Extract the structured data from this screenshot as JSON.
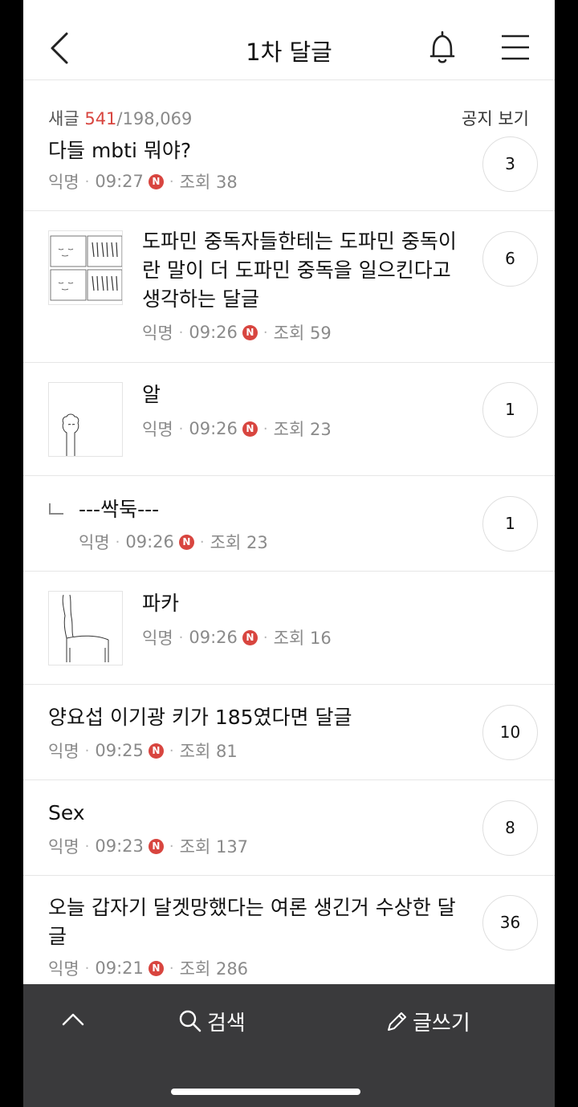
{
  "header": {
    "title": "1차 달글",
    "back_icon": "chevron-left-icon",
    "bell_icon": "bell-icon",
    "menu_icon": "hamburger-menu-icon"
  },
  "summary": {
    "new_label": "새글",
    "new_count": "541",
    "total": "/198,069",
    "notice_label": "공지 보기"
  },
  "posts": [
    {
      "title": "다들 mbti 뭐야?",
      "author": "익명",
      "time": "09:27",
      "badge": "N",
      "views": "조회 38",
      "comments": "3"
    },
    {
      "title": "도파민 중독자들한테는 도파민 중독이란 말이 더 도파민 중독을 일으킨다고 생각하는 달글",
      "author": "익명",
      "time": "09:26",
      "badge": "N",
      "views": "조회 59",
      "comments": "6"
    },
    {
      "title": "알",
      "author": "익명",
      "time": "09:26",
      "badge": "N",
      "views": "조회 23",
      "comments": "1"
    },
    {
      "title": "---싹둑---",
      "author": "익명",
      "time": "09:26",
      "badge": "N",
      "views": "조회 23",
      "comments": "1"
    },
    {
      "title": "파카",
      "author": "익명",
      "time": "09:26",
      "badge": "N",
      "views": "조회 16",
      "comments": ""
    },
    {
      "title": "양요섭 이기광 키가 185였다면 달글",
      "author": "익명",
      "time": "09:25",
      "badge": "N",
      "views": "조회 81",
      "comments": "10"
    },
    {
      "title": "Sex",
      "author": "익명",
      "time": "09:23",
      "badge": "N",
      "views": "조회 137",
      "comments": "8"
    },
    {
      "title": "오늘 갑자기 달겟망했다는 여론 생긴거 수상한 달글",
      "author": "익명",
      "time": "09:21",
      "badge": "N",
      "views": "조회 286",
      "comments": "36"
    }
  ],
  "bottom_bar": {
    "up_icon": "chevron-up-icon",
    "search_icon": "search-icon",
    "search_label": "검색",
    "write_icon": "pencil-icon",
    "write_label": "글쓰기"
  },
  "colors": {
    "accent": "#d8453f",
    "bottom_bar": "#3a3a3c"
  }
}
